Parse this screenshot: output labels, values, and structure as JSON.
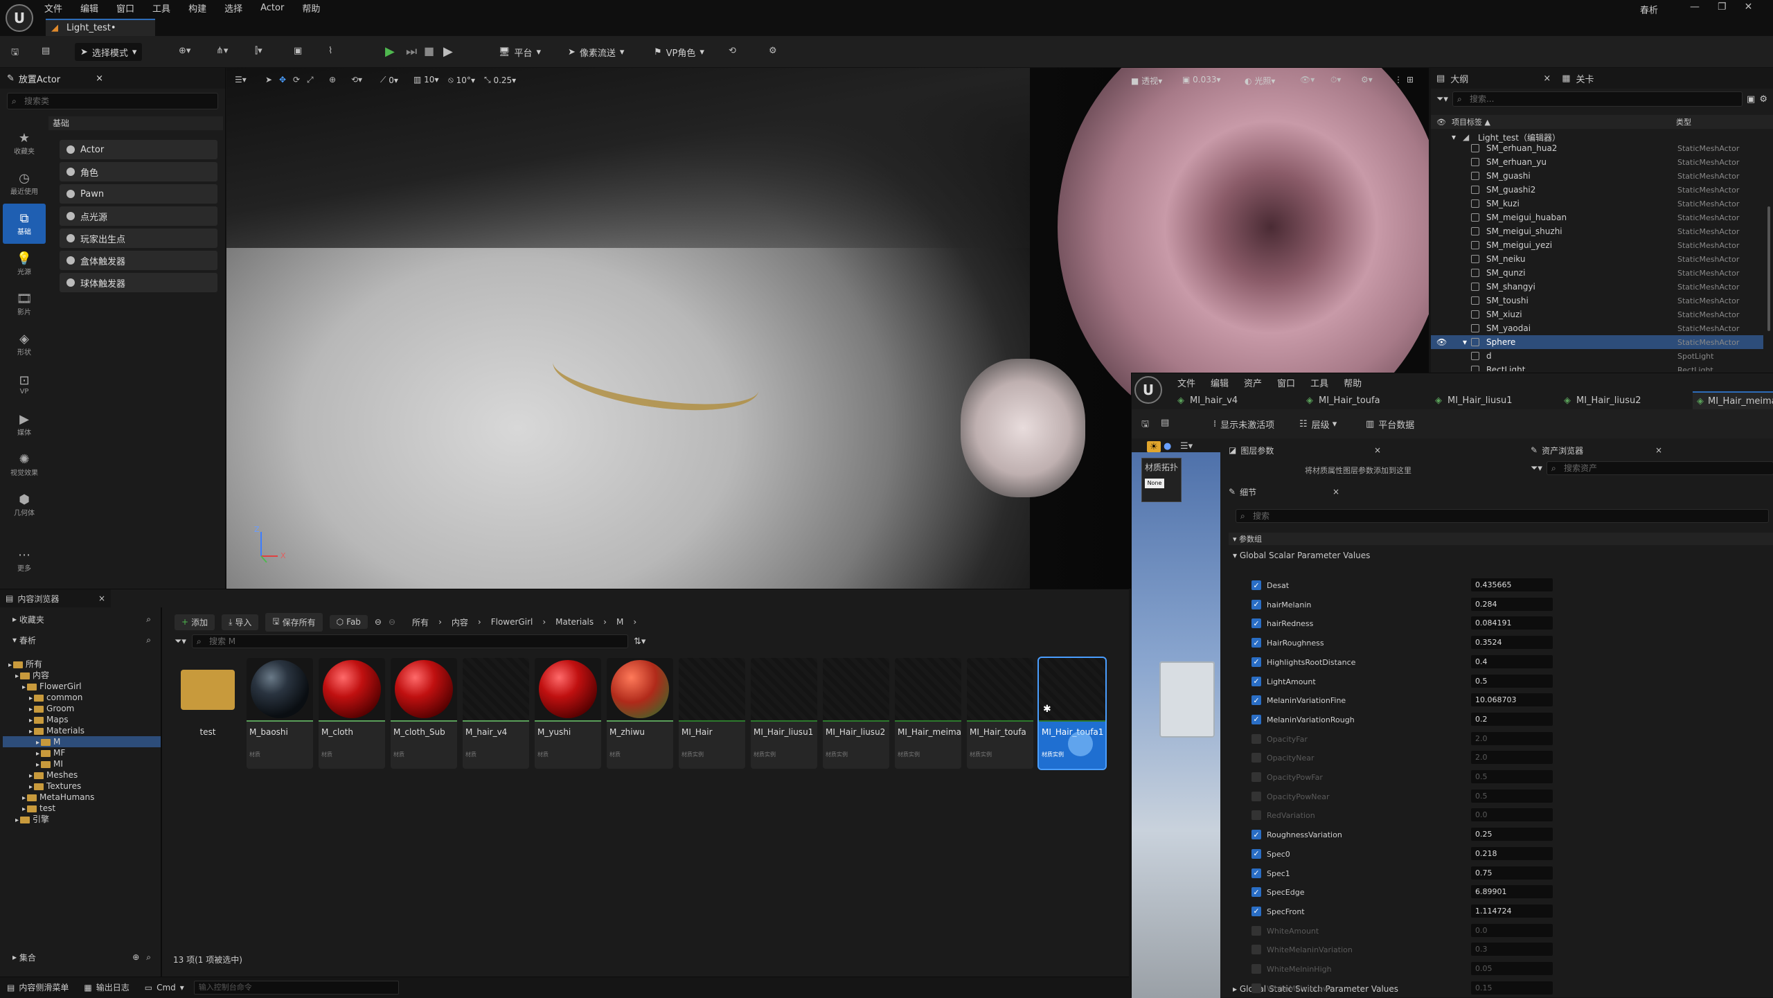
{
  "app": {
    "menu": [
      "文件",
      "编辑",
      "窗口",
      "工具",
      "构建",
      "选择",
      "Actor",
      "帮助"
    ],
    "doc_tab": "Light_test•",
    "project_name": "春析",
    "window_controls": [
      "—",
      "❐",
      "✕"
    ]
  },
  "toolbar": {
    "mode": "选择模式",
    "platform": "平台",
    "pixel_stream": "像素流送",
    "vp_role": "VP角色"
  },
  "place_actors": {
    "tab": "放置Actor",
    "search_placeholder": "搜索类",
    "section": "基础",
    "categories": [
      "收藏夹",
      "最近使用",
      "基础",
      "光源",
      "影片",
      "形状",
      "VP",
      "媒体",
      "视觉效果",
      "几何体",
      "更多"
    ],
    "items": [
      "Actor",
      "角色",
      "Pawn",
      "点光源",
      "玩家出生点",
      "盒体触发器",
      "球体触发器"
    ]
  },
  "viewport": {
    "view_mode": "透视",
    "lit_mode": "光照",
    "snap_angle": "0",
    "snap_grid": "10",
    "snap_rot": "10°",
    "snap_scale": "0.25",
    "camera_speed": "0.033",
    "axis_x": "X",
    "axis_z": "Z"
  },
  "outliner": {
    "tabs": [
      "大纲",
      "关卡"
    ],
    "search_placeholder": "搜索...",
    "col_label": "项目标签 ▲",
    "col_type": "类型",
    "root": "Light_test（编辑器）",
    "rows": [
      {
        "name": "SM_erhuan_hua2",
        "type": "StaticMeshActor"
      },
      {
        "name": "SM_erhuan_yu",
        "type": "StaticMeshActor"
      },
      {
        "name": "SM_guashi",
        "type": "StaticMeshActor"
      },
      {
        "name": "SM_guashi2",
        "type": "StaticMeshActor"
      },
      {
        "name": "SM_kuzi",
        "type": "StaticMeshActor"
      },
      {
        "name": "SM_meigui_huaban",
        "type": "StaticMeshActor"
      },
      {
        "name": "SM_meigui_shuzhi",
        "type": "StaticMeshActor"
      },
      {
        "name": "SM_meigui_yezi",
        "type": "StaticMeshActor"
      },
      {
        "name": "SM_neiku",
        "type": "StaticMeshActor"
      },
      {
        "name": "SM_qunzi",
        "type": "StaticMeshActor"
      },
      {
        "name": "SM_shangyi",
        "type": "StaticMeshActor"
      },
      {
        "name": "SM_toushi",
        "type": "StaticMeshActor"
      },
      {
        "name": "SM_xiuzi",
        "type": "StaticMeshActor"
      },
      {
        "name": "SM_yaodai",
        "type": "StaticMeshActor"
      },
      {
        "name": "Sphere",
        "type": "StaticMeshActor"
      },
      {
        "name": "d",
        "type": "SpotLight"
      },
      {
        "name": "RectLight",
        "type": "RectLight"
      }
    ]
  },
  "material_editor": {
    "menu": [
      "文件",
      "编辑",
      "资产",
      "窗口",
      "工具",
      "帮助"
    ],
    "tabs": [
      "MI_hair_v4",
      "MI_Hair_toufa",
      "MI_Hair_liusu1",
      "MI_Hair_liusu2",
      "MI_Hair_meimao"
    ],
    "toolbar": {
      "show_inactive": "显示未激活项",
      "hierarchy": "层级",
      "platform_data": "平台数据"
    },
    "layer_params_tab": "图层参数",
    "layer_params_msg": "将材质属性图层参数添加到这里",
    "asset_browser_tab": "资产浏览器",
    "asset_search_placeholder": "搜索资产",
    "material_topology": "材质拓扑",
    "none_label": "None",
    "details_tab": "细节",
    "details_search_placeholder": "搜索",
    "param_group": "参数组",
    "scalar_section": "Global Scalar Parameter Values",
    "switch_section": "Global Static Switch Parameter Values",
    "params": [
      {
        "name": "Desat",
        "value": "0.435665",
        "on": true
      },
      {
        "name": "hairMelanin",
        "value": "0.284",
        "on": true
      },
      {
        "name": "hairRedness",
        "value": "0.084191",
        "on": true
      },
      {
        "name": "HairRoughness",
        "value": "0.3524",
        "on": true
      },
      {
        "name": "HighlightsRootDistance",
        "value": "0.4",
        "on": true
      },
      {
        "name": "LightAmount",
        "value": "0.5",
        "on": true
      },
      {
        "name": "MelaninVariationFine",
        "value": "10.068703",
        "on": true
      },
      {
        "name": "MelaninVariationRough",
        "value": "0.2",
        "on": true
      },
      {
        "name": "OpacityFar",
        "value": "2.0",
        "on": false
      },
      {
        "name": "OpacityNear",
        "value": "2.0",
        "on": false
      },
      {
        "name": "OpacityPowFar",
        "value": "0.5",
        "on": false
      },
      {
        "name": "OpacityPowNear",
        "value": "0.5",
        "on": false
      },
      {
        "name": "RedVariation",
        "value": "0.0",
        "on": false
      },
      {
        "name": "RoughnessVariation",
        "value": "0.25",
        "on": true
      },
      {
        "name": "Spec0",
        "value": "0.218",
        "on": true
      },
      {
        "name": "Spec1",
        "value": "0.75",
        "on": true
      },
      {
        "name": "SpecEdge",
        "value": "6.89901",
        "on": true
      },
      {
        "name": "SpecFront",
        "value": "1.114724",
        "on": true
      },
      {
        "name": "WhiteAmount",
        "value": "0.0",
        "on": false
      },
      {
        "name": "WhiteMelaninVariation",
        "value": "0.3",
        "on": false
      },
      {
        "name": "WhiteMelninHigh",
        "value": "0.05",
        "on": false
      },
      {
        "name": "WhiteMelninLow",
        "value": "0.15",
        "on": false
      }
    ]
  },
  "content_browser": {
    "tab": "内容浏览器",
    "favorites": "收藏夹",
    "project": "春析",
    "collections": "集合",
    "add": "添加",
    "import": "导入",
    "save_all": "保存所有",
    "fab": "Fab",
    "breadcrumb": [
      "所有",
      "内容",
      "FlowerGirl",
      "Materials",
      "M"
    ],
    "search_placeholder": "搜索 M",
    "tree": [
      {
        "label": "所有",
        "depth": 0
      },
      {
        "label": "内容",
        "depth": 1
      },
      {
        "label": "FlowerGirl",
        "depth": 2
      },
      {
        "label": "common",
        "depth": 3
      },
      {
        "label": "Groom",
        "depth": 3
      },
      {
        "label": "Maps",
        "depth": 3
      },
      {
        "label": "Materials",
        "depth": 3
      },
      {
        "label": "M",
        "depth": 4
      },
      {
        "label": "MF",
        "depth": 4
      },
      {
        "label": "MI",
        "depth": 4
      },
      {
        "label": "Meshes",
        "depth": 3
      },
      {
        "label": "Textures",
        "depth": 3
      },
      {
        "label": "MetaHumans",
        "depth": 2
      },
      {
        "label": "test",
        "depth": 2
      },
      {
        "label": "引擎",
        "depth": 1
      }
    ],
    "assets": [
      {
        "name": "test",
        "type": "",
        "kind": "folder"
      },
      {
        "name": "M_baoshi",
        "type": "材质",
        "kind": "black"
      },
      {
        "name": "M_cloth",
        "type": "材质",
        "kind": "red"
      },
      {
        "name": "M_cloth_Sub",
        "type": "材质",
        "kind": "red"
      },
      {
        "name": "M_hair_v4",
        "type": "材质",
        "kind": "dark"
      },
      {
        "name": "M_yushi",
        "type": "材质",
        "kind": "red"
      },
      {
        "name": "M_zhiwu",
        "type": "材质",
        "kind": "redgreen"
      },
      {
        "name": "MI_Hair",
        "type": "材质实例",
        "kind": "dark"
      },
      {
        "name": "MI_Hair_liusu1",
        "type": "材质实例",
        "kind": "dark"
      },
      {
        "name": "MI_Hair_liusu2",
        "type": "材质实例",
        "kind": "dark"
      },
      {
        "name": "MI_Hair_meimao",
        "type": "材质实例",
        "kind": "dark"
      },
      {
        "name": "MI_Hair_toufa",
        "type": "材质实例",
        "kind": "dark"
      },
      {
        "name": "MI_Hair_toufa1",
        "type": "材质实例",
        "kind": "dark"
      }
    ],
    "status": "13 项(1 项被选中)"
  },
  "statusbar": {
    "drawer": "内容侧滑菜单",
    "output_log": "输出日志",
    "cmd": "Cmd",
    "cmd_placeholder": "输入控制台命令"
  }
}
